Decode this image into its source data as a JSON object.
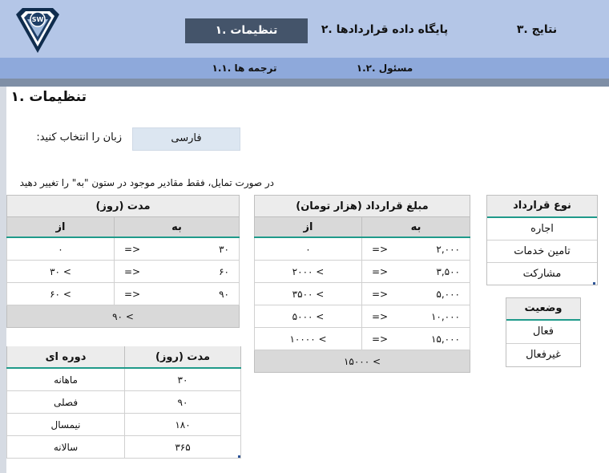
{
  "nav": {
    "items": [
      {
        "label": "نتایج .۳"
      },
      {
        "label": "پایگاه داده قراردادها .۲"
      },
      {
        "label": "تنظیمات .۱"
      }
    ],
    "sub_items": [
      {
        "label": "مسئول .۱.۲"
      },
      {
        "label": "ترجمه ها .۱.۱"
      }
    ]
  },
  "page": {
    "title": "تنظیمات .۱",
    "language_label": "زبان را انتخاب کنید:",
    "language_value": "فارسی",
    "hint": "در صورت تمایل، فقط مقادیر موجود در ستون \"به\" را تغییر دهید"
  },
  "duration_table": {
    "title": "مدت (روز)",
    "col_to": "به",
    "col_from": "از",
    "rows": [
      {
        "to": "۳۰",
        "op": "=>",
        "from": "۰"
      },
      {
        "to": "۶۰",
        "op": "=>",
        "from": "۳۰ <"
      },
      {
        "to": "۹۰",
        "op": "=>",
        "from": "۶۰ <"
      }
    ],
    "footer": "۹۰ <"
  },
  "amount_table": {
    "title": "مبلغ قرارداد (هزار تومان)",
    "col_to": "به",
    "col_from": "از",
    "rows": [
      {
        "to": "۲,۰۰۰",
        "op": "=>",
        "from": "۰"
      },
      {
        "to": "۳,۵۰۰",
        "op": "=>",
        "from": "۲۰۰۰ <"
      },
      {
        "to": "۵,۰۰۰",
        "op": "=>",
        "from": "۳۵۰۰ <"
      },
      {
        "to": "۱۰,۰۰۰",
        "op": "=>",
        "from": "۵۰۰۰ <"
      },
      {
        "to": "۱۵,۰۰۰",
        "op": "=>",
        "from": "۱۰۰۰۰ <"
      }
    ],
    "footer": "۱۵۰۰۰ <"
  },
  "contract_type": {
    "title": "نوع قرارداد",
    "items": [
      "اجاره",
      "تامین خدمات",
      "مشارکت"
    ]
  },
  "status": {
    "title": "وضعیت",
    "items": [
      "فعال",
      "غیرفعال"
    ]
  },
  "period_table": {
    "col_days": "مدت (روز)",
    "col_period": "دوره ای",
    "rows": [
      {
        "days": "۳۰",
        "period": "ماهانه"
      },
      {
        "days": "۹۰",
        "period": "فصلی"
      },
      {
        "days": "۱۸۰",
        "period": "نیمسال"
      },
      {
        "days": "۳۶۵",
        "period": "سالانه"
      }
    ]
  },
  "logo": {
    "text": "SW"
  },
  "colors": {
    "accent": "#1f9a8a",
    "header_bg": "#b4c6e7",
    "subheader_bg": "#8ea9db",
    "active_tab": "#44546a"
  }
}
